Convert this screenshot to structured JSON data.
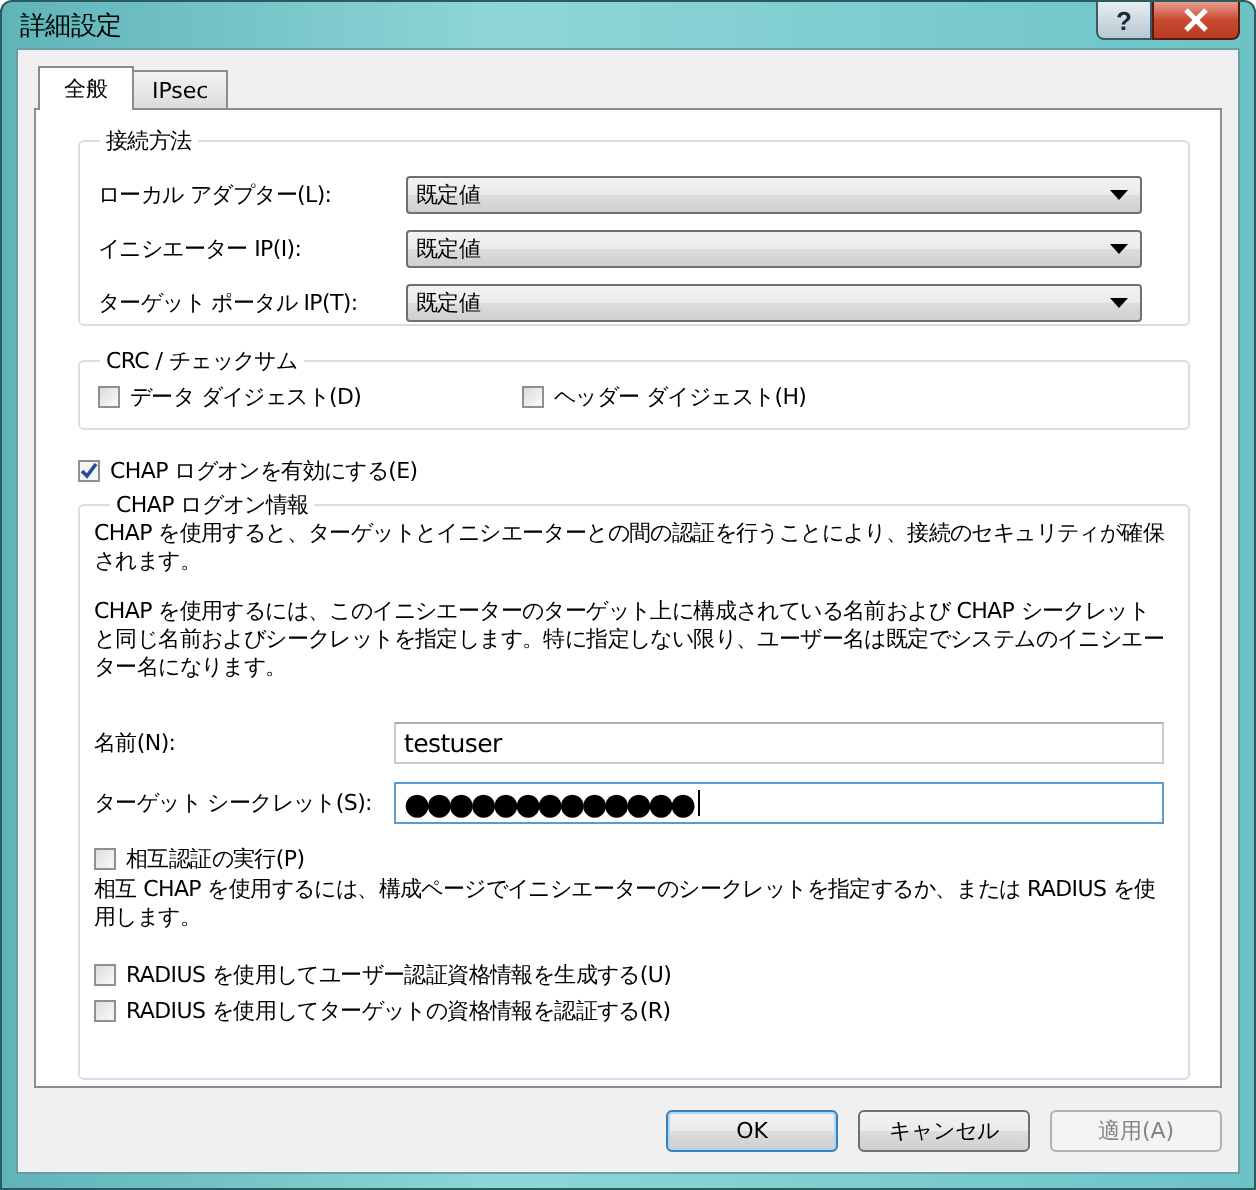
{
  "window": {
    "title": "詳細設定",
    "help_button": "?"
  },
  "tabs": [
    {
      "label": "全般",
      "selected": true
    },
    {
      "label": "IPsec",
      "selected": false
    }
  ],
  "connection_group": {
    "title": "接続方法",
    "rows": [
      {
        "label": "ローカル アダプター(L):",
        "value": "既定値"
      },
      {
        "label": "イニシエーター IP(I):",
        "value": "既定値"
      },
      {
        "label": "ターゲット ポータル IP(T):",
        "value": "既定値"
      }
    ]
  },
  "crc_group": {
    "title": "CRC / チェックサム",
    "checkboxes": [
      {
        "label": "データ ダイジェスト(D)",
        "checked": false
      },
      {
        "label": "ヘッダー ダイジェスト(H)",
        "checked": false
      }
    ]
  },
  "chap_enable": {
    "label": "CHAP ログオンを有効にする(E)",
    "checked": true
  },
  "chap_group": {
    "title": "CHAP ログオン情報",
    "paragraphs": [
      "CHAP を使用すると、ターゲットとイニシエーターとの間の認証を行うことにより、接続のセキュリティが確保されます。",
      "CHAP を使用するには、このイニシエーターのターゲット上に構成されている名前および CHAP シークレットと同じ名前およびシークレットを指定します。特に指定しない限り、ユーザー名は既定でシステムのイニシエーター名になります。"
    ],
    "fields": [
      {
        "label": "名前(N):",
        "value": "testuser",
        "focused": false
      },
      {
        "label": "ターゲット シークレット(S):",
        "value": "●●●●●●●●●●●●●",
        "focused": true
      }
    ],
    "mutual": {
      "label": "相互認証の実行(P)",
      "checked": false
    },
    "mutual_note": "相互 CHAP を使用するには、構成ページでイニシエーターのシークレットを指定するか、または RADIUS を使用します。",
    "radius": [
      {
        "label": "RADIUS を使用してユーザー認証資格情報を生成する(U)",
        "checked": false
      },
      {
        "label": "RADIUS を使用してターゲットの資格情報を認証する(R)",
        "checked": false
      }
    ]
  },
  "buttons": [
    {
      "label": "OK",
      "default": true,
      "disabled": false
    },
    {
      "label": "キャンセル",
      "default": false,
      "disabled": false
    },
    {
      "label": "適用(A)",
      "default": false,
      "disabled": true
    }
  ]
}
